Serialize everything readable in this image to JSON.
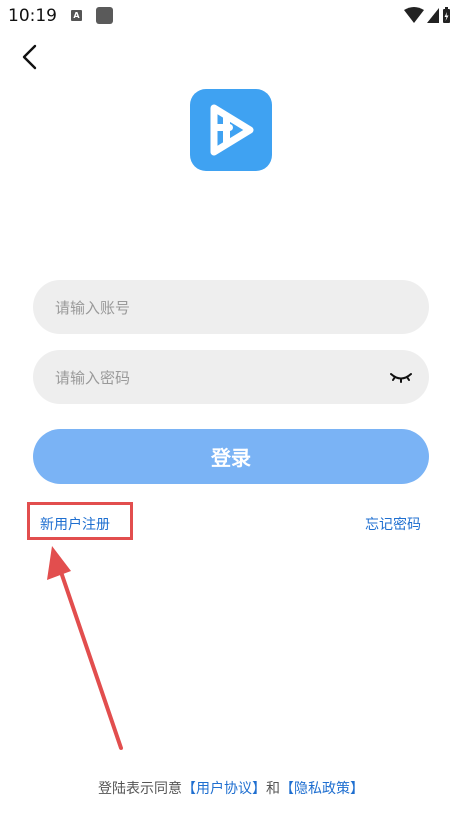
{
  "status_bar": {
    "time": "10:19",
    "notification_badge": "A"
  },
  "login": {
    "account_placeholder": "请输入账号",
    "password_placeholder": "请输入密码",
    "login_label": "登录",
    "register_label": "新用户注册",
    "forgot_label": "忘记密码"
  },
  "agreement": {
    "prefix": "登陆表示同意",
    "user_agreement": "【用户协议】",
    "conjunction": "和",
    "privacy_policy": "【隐私政策】"
  },
  "colors": {
    "brand_blue": "#3fa2f2",
    "login_button": "#7ab3f5",
    "link_blue": "#1f6fd0",
    "annotation_red": "#e24e4e",
    "input_bg": "#eeeeee"
  }
}
